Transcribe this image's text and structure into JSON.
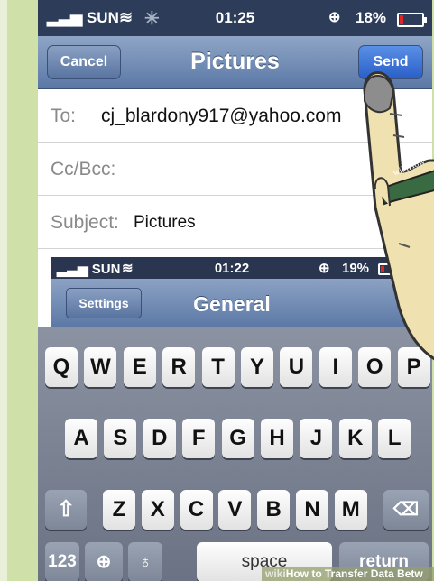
{
  "status_bar": {
    "carrier": "SUN",
    "time": "01:25",
    "battery": "18%",
    "battery_fill": 0.18
  },
  "nav": {
    "cancel_label": "Cancel",
    "title": "Pictures",
    "send_label": "Send"
  },
  "compose": {
    "to_label": "To:",
    "to_value": "cj_blardony917@yahoo.com",
    "cc_label": "Cc/Bcc:",
    "subject_label": "Subject:",
    "subject_value": "Pictures"
  },
  "inset": {
    "status": {
      "carrier": "SUN",
      "time": "01:22",
      "battery": "19%"
    },
    "back_label": "Settings",
    "title": "General"
  },
  "keyboard": {
    "row1": [
      "Q",
      "W",
      "E",
      "R",
      "T",
      "Y",
      "U",
      "I",
      "O",
      "P"
    ],
    "row2": [
      "A",
      "S",
      "D",
      "F",
      "G",
      "H",
      "J",
      "K",
      "L"
    ],
    "row3": [
      "Z",
      "X",
      "C",
      "V",
      "B",
      "N",
      "M"
    ],
    "numbers_label": "123",
    "space_label": "space",
    "return_label": "return"
  },
  "hand": {
    "band_text": "wikiHow"
  },
  "watermark": {
    "prefix": "wiki",
    "text": "How to Transfer Data Betw"
  }
}
